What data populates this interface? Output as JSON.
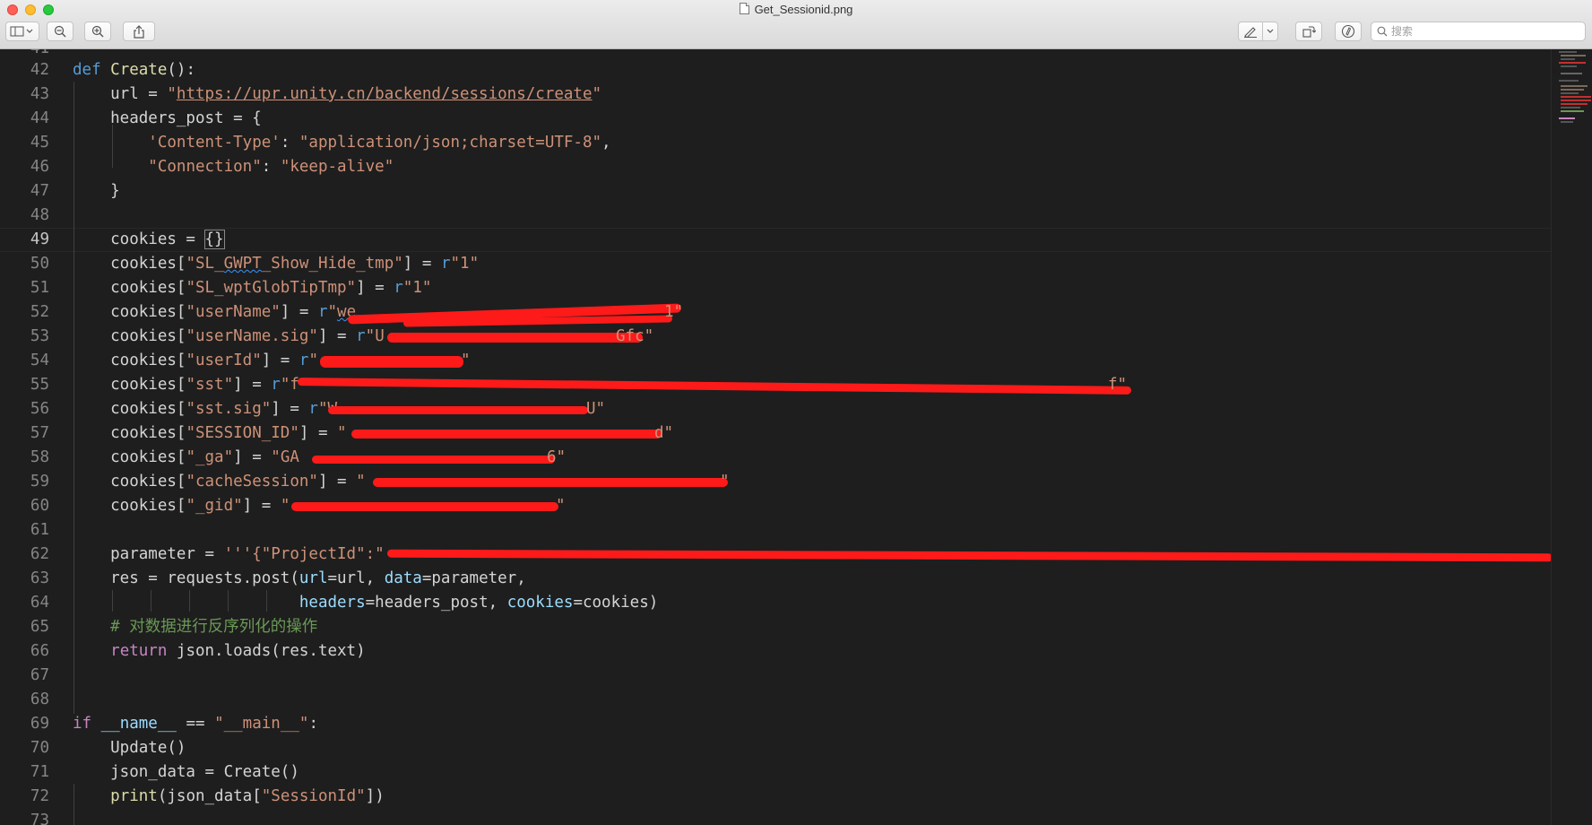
{
  "window": {
    "title": "Get_Sessionid.png"
  },
  "toolbar": {
    "search_placeholder": "搜索",
    "icons": [
      "sidebar-icon",
      "chevron-down-icon",
      "zoom-out-icon",
      "zoom-in-icon",
      "share-icon",
      "markup-pen-icon",
      "chevron-down-icon",
      "rotate-icon",
      "annotate-icon",
      "search-icon"
    ]
  },
  "editor": {
    "partial_top_line": "41",
    "partial_bottom_line": "73",
    "current_line": "49",
    "lines": [
      {
        "n": "42",
        "t": "def Create():"
      },
      {
        "n": "43",
        "t": "    url = \"https://upr.unity.cn/backend/sessions/create\""
      },
      {
        "n": "44",
        "t": "    headers_post = {"
      },
      {
        "n": "45",
        "t": "        'Content-Type': \"application/json;charset=UTF-8\","
      },
      {
        "n": "46",
        "t": "        \"Connection\": \"keep-alive\""
      },
      {
        "n": "47",
        "t": "    }"
      },
      {
        "n": "48",
        "t": ""
      },
      {
        "n": "49",
        "t": "    cookies = {}"
      },
      {
        "n": "50",
        "t": "    cookies[\"SL_GWPT_Show_Hide_tmp\"] = r\"1\""
      },
      {
        "n": "51",
        "t": "    cookies[\"SL_wptGlobTipTmp\"] = r\"1\""
      },
      {
        "n": "52",
        "t": "    cookies[\"userName\"] = r\"we"
      },
      {
        "n": "53",
        "t": "    cookies[\"userName.sig\"] = r\"U"
      },
      {
        "n": "54",
        "t": "    cookies[\"userId\"] = r\""
      },
      {
        "n": "55",
        "t": "    cookies[\"sst\"] = r\"f"
      },
      {
        "n": "56",
        "t": "    cookies[\"sst.sig\"] = r\"W"
      },
      {
        "n": "57",
        "t": "    cookies[\"SESSION_ID\"] = \""
      },
      {
        "n": "58",
        "t": "    cookies[\"_ga\"] = \"GA"
      },
      {
        "n": "59",
        "t": "    cookies[\"cacheSession\"] = \""
      },
      {
        "n": "60",
        "t": "    cookies[\"_gid\"] = \""
      },
      {
        "n": "61",
        "t": ""
      },
      {
        "n": "62",
        "t": "    parameter = '''{\"ProjectId\":\""
      },
      {
        "n": "63",
        "t": "    res = requests.post(url=url, data=parameter,"
      },
      {
        "n": "64",
        "t": "                        headers=headers_post, cookies=cookies)"
      },
      {
        "n": "65",
        "t": "    # 对数据进行反序列化的操作"
      },
      {
        "n": "66",
        "t": "    return json.loads(res.text)"
      },
      {
        "n": "67",
        "t": ""
      },
      {
        "n": "68",
        "t": ""
      },
      {
        "n": "69",
        "t": "if __name__ == \"__main__\":"
      },
      {
        "n": "70",
        "t": "    Update()"
      },
      {
        "n": "71",
        "t": "    json_data = Create()"
      },
      {
        "n": "72",
        "t": "    print(json_data[\"SessionId\"])"
      }
    ]
  },
  "colors": {
    "background": "#1e1e1e",
    "keyword": "#569cd6",
    "control_keyword": "#c586c0",
    "function": "#dcdcaa",
    "string": "#ce9178",
    "variable": "#9cdcfe",
    "comment": "#6a9955",
    "line_number": "#858585",
    "redaction": "#ff1a1a"
  }
}
